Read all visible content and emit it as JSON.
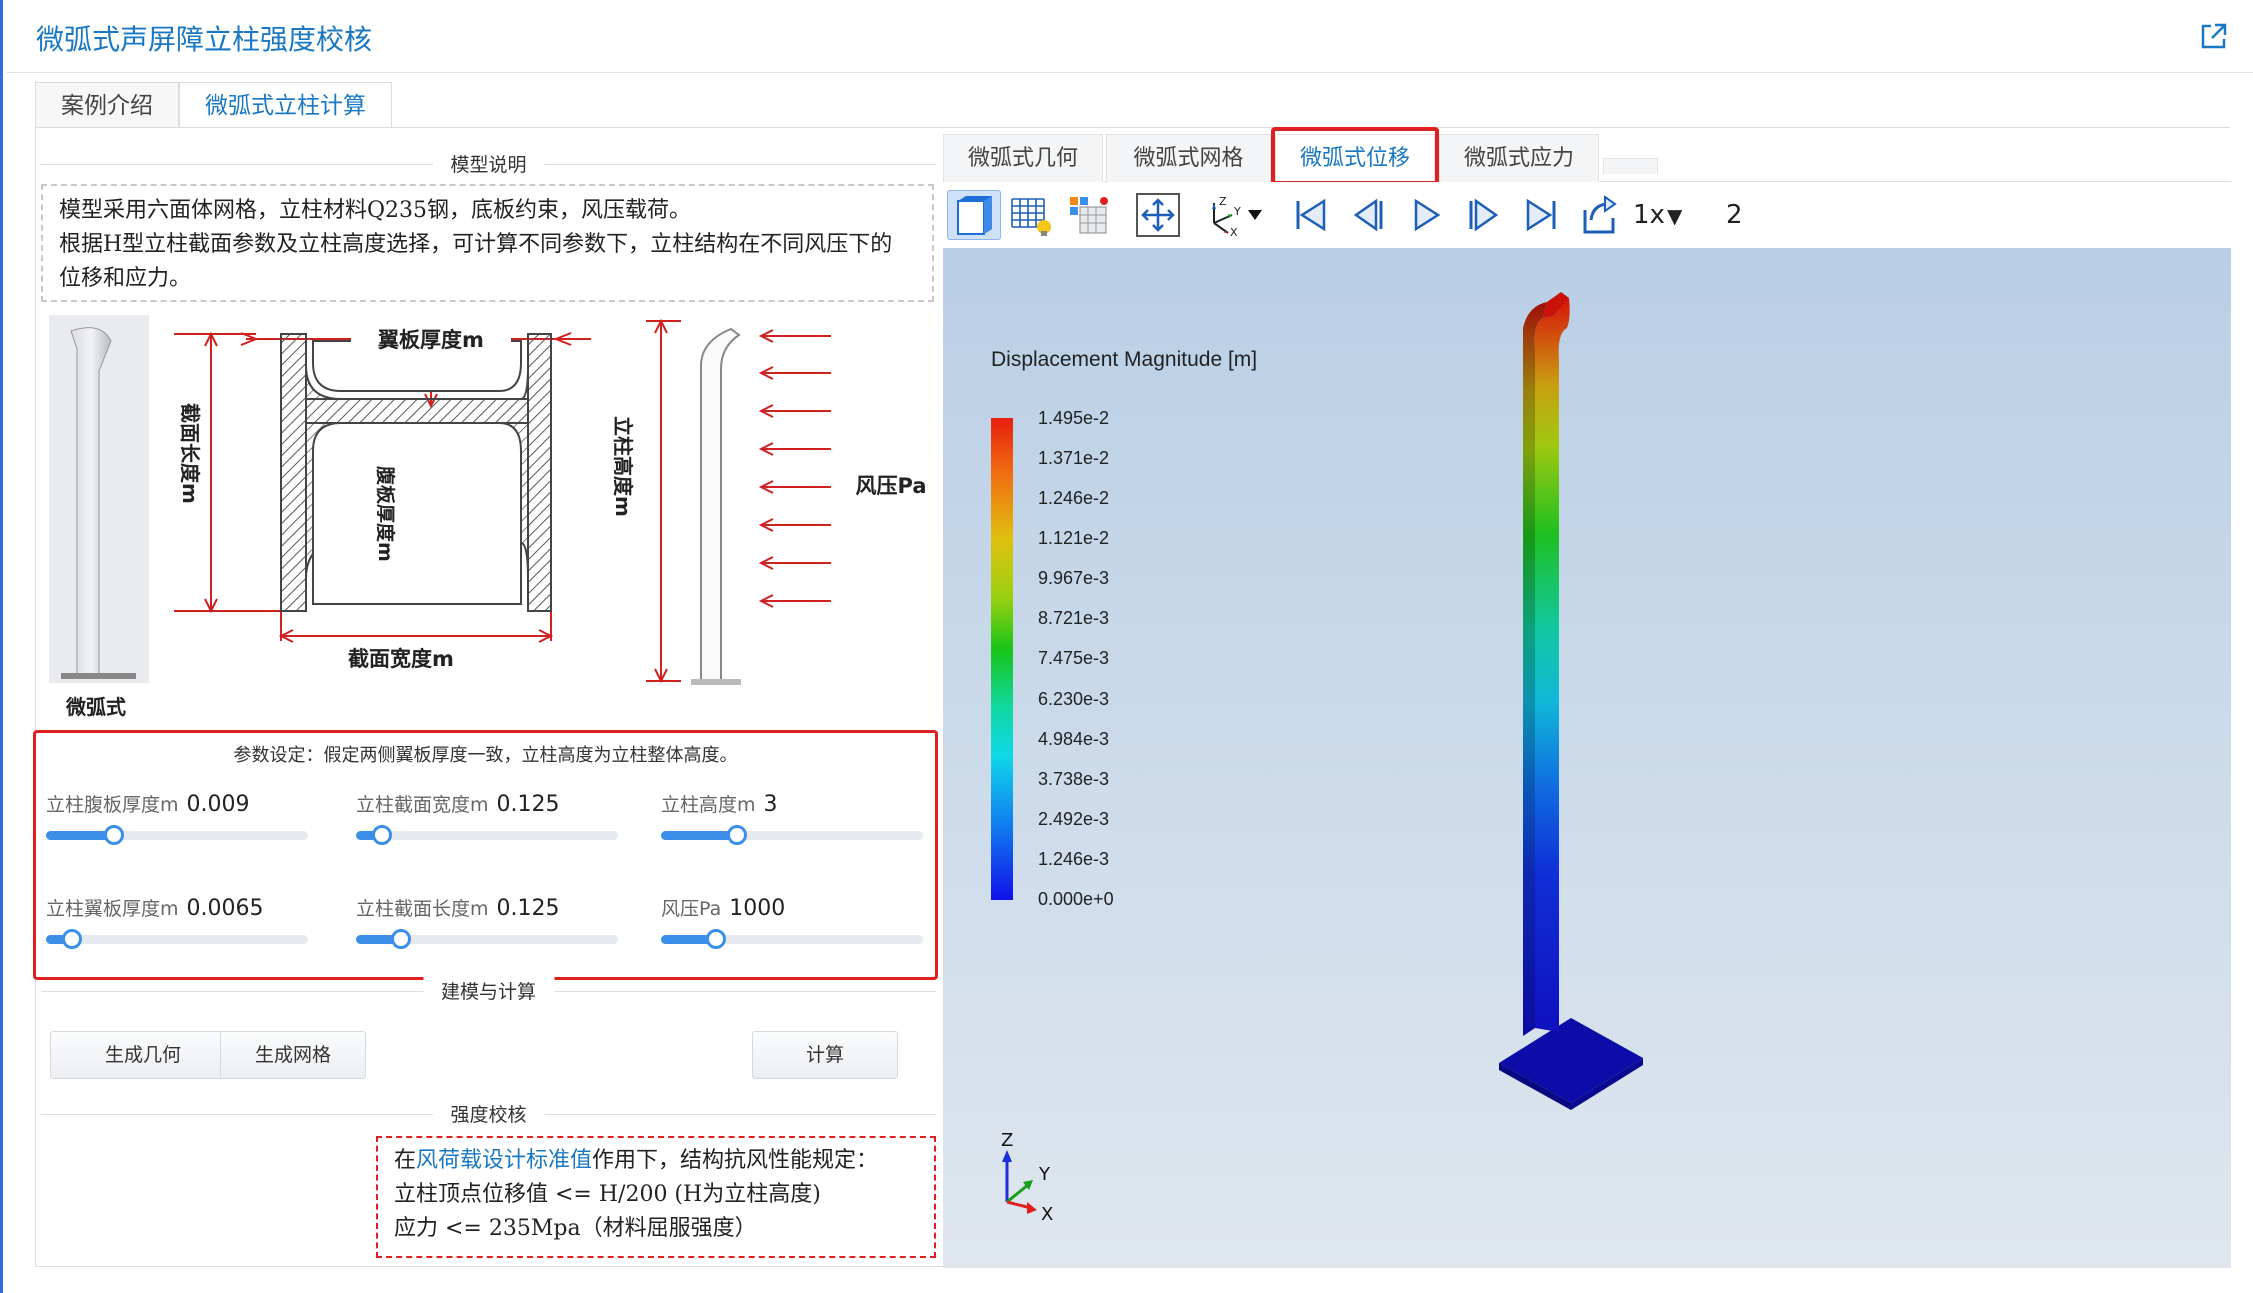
{
  "header": {
    "title": "微弧式声屏障立柱强度校核"
  },
  "main_tabs": [
    {
      "label": "案例介绍"
    },
    {
      "label": "微弧式立柱计算"
    }
  ],
  "left": {
    "model_section": "模型说明",
    "description_lines": [
      "模型采用六面体网格，立柱材料Q235钢，底板约束，风压载荷。",
      "根据H型立柱截面参数及立柱高度选择，可计算不同参数下，立柱结构在不同风压下的",
      "位移和应力。"
    ],
    "diagram": {
      "post_caption": "微弧式",
      "flange_label": "翼板厚度m",
      "section_length_label": "截面长度m",
      "web_label": "腹板厚度m",
      "section_width_label": "截面宽度m",
      "height_label": "立柱高度m",
      "wind_label": "风压Pa"
    },
    "params": {
      "title": "参数设定：假定两侧翼板厚度一致，立柱高度为立柱整体高度。",
      "items": [
        {
          "label": "立柱腹板厚度m",
          "value": "0.009",
          "level": 0.26
        },
        {
          "label": "立柱截面宽度m",
          "value": "0.125",
          "level": 0.1
        },
        {
          "label": "立柱高度m",
          "value": "3",
          "level": 0.29
        },
        {
          "label": "立柱翼板厚度m",
          "value": "0.0065",
          "level": 0.1
        },
        {
          "label": "立柱截面长度m",
          "value": "0.125",
          "level": 0.17
        },
        {
          "label": "风压Pa",
          "value": "1000",
          "level": 0.21
        }
      ]
    },
    "build_section": "建模与计算",
    "buttons": {
      "geometry": "生成几何",
      "mesh": "生成网格",
      "compute": "计算"
    },
    "check_section": "强度校核",
    "note": {
      "prefix": "在",
      "link": "风荷载设计标准值",
      "suffix": "作用下，结构抗风性能规定：",
      "line2": "立柱顶点位移值 <= H/200 (H为立柱高度)",
      "line3": "应力 <= 235Mpa（材料屈服强度）"
    }
  },
  "viewer": {
    "tabs": [
      {
        "label": "微弧式几何"
      },
      {
        "label": "微弧式网格"
      },
      {
        "label": "微弧式位移"
      },
      {
        "label": "微弧式应力"
      }
    ],
    "active_tab": "微弧式位移",
    "speed": "1x",
    "step": "2",
    "colorbar": {
      "title": "Displacement Magnitude [m]",
      "labels": [
        "1.495e-2",
        "1.371e-2",
        "1.246e-2",
        "1.121e-2",
        "9.967e-3",
        "8.721e-3",
        "7.475e-3",
        "6.230e-3",
        "4.984e-3",
        "3.738e-3",
        "2.492e-3",
        "1.246e-3",
        "0.000e+0"
      ]
    },
    "axes": {
      "z": "Z",
      "y": "Y",
      "x": "X"
    }
  },
  "colors": {
    "accent": "#1a78c2",
    "highlight": "#e02020",
    "slider": "#3b8fe8"
  }
}
